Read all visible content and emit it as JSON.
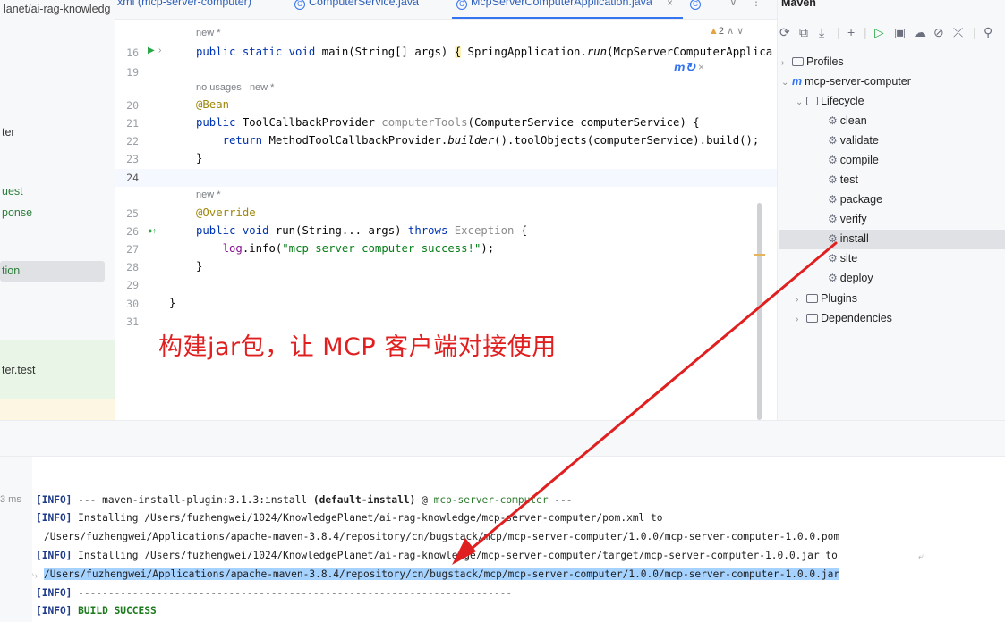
{
  "project": {
    "path_fragment": "lanet/ai-rag-knowledg",
    "items": [
      "ter",
      "uest",
      "ponse",
      "tion",
      "ter.test"
    ]
  },
  "tabs": {
    "tab1": "xml (mcp-server-computer)",
    "tab2": "ComputerService.java",
    "tab3": "McpServerComputerApplication.java",
    "close": "×",
    "chevron": "∨",
    "more": "⋮"
  },
  "editor": {
    "warning_count": "2",
    "hints": {
      "new": "new *",
      "no_usages": "no usages",
      "new2": "new *",
      "new3": "new *"
    },
    "line_numbers": [
      "16",
      "19",
      "20",
      "21",
      "22",
      "23",
      "24",
      "25",
      "26",
      "27",
      "28",
      "29",
      "30",
      "31"
    ],
    "code": {
      "l16_kw": "public static void",
      "l16_main": " main(String[] args) ",
      "l16_brace": "{",
      "l16_body": " SpringApplication.",
      "l16_run": "run",
      "l16_tail": "(McpServerComputerApplica",
      "l20": "@Bean",
      "l21_kw": "public",
      "l21_type": " ToolCallbackProvider ",
      "l21_name": "computerTools",
      "l21_rest": "(ComputerService computerService) {",
      "l22_kw": "return",
      "l22_a": " MethodToolCallbackProvider.",
      "l22_builder": "builder",
      "l22_b": "().toolObjects(computerService).build();",
      "l23": "}",
      "l25": "@Override",
      "l26_kw": "public void",
      "l26_a": " run(String... args) ",
      "l26_throws": "throws",
      "l26_exc": " Exception",
      "l26_b": " {",
      "l27_log": "log",
      "l27_a": ".info(",
      "l27_str": "\"mcp server computer success!\"",
      "l27_b": ");",
      "l28": "}",
      "l30": "}"
    }
  },
  "caption": "构建jar包，让 MCP 客户端对接使用",
  "maven": {
    "title": "Maven",
    "tree": {
      "profiles": "Profiles",
      "project": "mcp-server-computer",
      "lifecycle": "Lifecycle",
      "phases": [
        "clean",
        "validate",
        "compile",
        "test",
        "package",
        "verify",
        "install",
        "site",
        "deploy"
      ],
      "plugins": "Plugins",
      "dependencies": "Dependencies"
    },
    "selected_phase": "install"
  },
  "console": {
    "time_label": "3 ms",
    "info_tag": "[INFO]",
    "line1_a": " --- maven-install-plugin:3.1.3:install ",
    "line1_b": "(default-install)",
    "line1_c": " @ ",
    "line1_d": "mcp-server-computer",
    "line1_e": " ---",
    "line2": " Installing /Users/fuzhengwei/1024/KnowledgePlanet/ai-rag-knowledge/mcp-server-computer/pom.xml to",
    "line3": "/Users/fuzhengwei/Applications/apache-maven-3.8.4/repository/cn/bugstack/mcp/mcp-server-computer/1.0.0/mcp-server-computer-1.0.0.pom",
    "line4": " Installing /Users/fuzhengwei/1024/KnowledgePlanet/ai-rag-knowledge/mcp-server-computer/target/mcp-server-computer-1.0.0.jar to",
    "line5": "/Users/fuzhengwei/Applications/apache-maven-3.8.4/repository/cn/bugstack/mcp/mcp-server-computer/1.0.0/mcp-server-computer-1.0.0.jar",
    "line6": " ------------------------------------------------------------------------",
    "line7": " BUILD SUCCESS"
  },
  "colors": {
    "accent": "#3574f0",
    "annotation_red": "#e02020",
    "selection": "#a6d2ff"
  }
}
